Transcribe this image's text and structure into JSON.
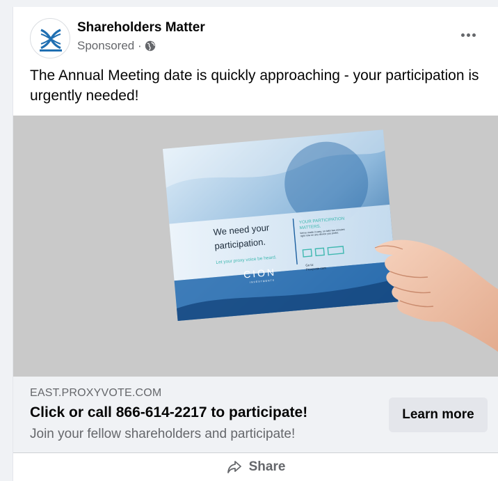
{
  "post": {
    "page_name": "Shareholders Matter",
    "sponsored": "Sponsored ·",
    "body": "The Annual Meeting date is quickly approaching - your participation is urgently needed!",
    "audience_icon": "globe-icon",
    "options_icon": "more-horizontal-icon"
  },
  "image": {
    "headline_line1": "We need your",
    "headline_line2": "participation.",
    "tagline": "Let your proxy voice be heard.",
    "brand": "CION",
    "brand_sub": "INVESTMENTS",
    "right_title_line1": "YOUR PARTICIPATION",
    "right_title_line2": "MATTERS.",
    "right_copy": "We've made it easy, so take two minutes right now on any device you prefer.",
    "goto": "Go to:",
    "goto_url": "Proxyvote.com"
  },
  "link": {
    "domain": "EAST.PROXYVOTE.COM",
    "headline": "Click or call 866-614-2217 to participate!",
    "description": "Join your fellow shareholders and participate!",
    "cta_label": "Learn more"
  },
  "actions": {
    "share_label": "Share",
    "share_icon": "share-arrow-icon"
  },
  "colors": {
    "brand_blue": "#1b5fa0",
    "accent_teal": "#3fb8b0",
    "muted_text": "#65676b",
    "media_bg": "#c9c9c9"
  }
}
